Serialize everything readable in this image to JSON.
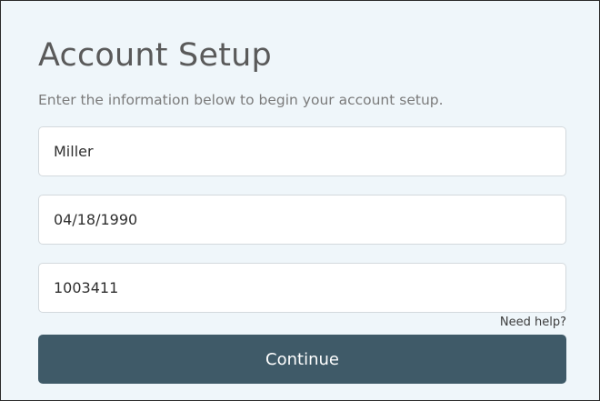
{
  "header": {
    "title": "Account Setup",
    "subtitle": "Enter the information below to begin your account setup."
  },
  "form": {
    "fields": [
      {
        "value": "Miller"
      },
      {
        "value": "04/18/1990"
      },
      {
        "value": "1003411"
      }
    ],
    "help_link": "Need help?",
    "continue_label": "Continue"
  },
  "colors": {
    "panel_background": "#eff6fa",
    "button_background": "#3f5a68",
    "button_text": "#ffffff"
  }
}
